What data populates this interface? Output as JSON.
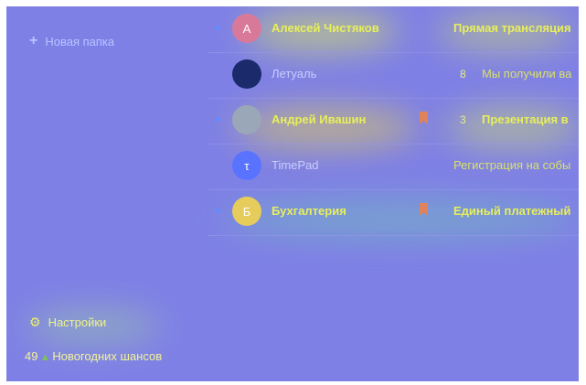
{
  "sidebar": {
    "new_folder_label": "Новая папка",
    "settings_label": "Настройки",
    "chances_count": "49",
    "chances_label": "Новогодних шансов"
  },
  "colors": {
    "background": "#7f80e6",
    "text_highlight": "#e8ef5a",
    "unread_dot": "#5f8cff",
    "bookmark": "#e0825a"
  },
  "messages": [
    {
      "unread": true,
      "avatar_letter": "А",
      "avatar_color": "#d9799a",
      "sender": "Алексей Чистяков",
      "bookmarked": false,
      "count": "",
      "subject": "Прямая трансляция"
    },
    {
      "unread": false,
      "avatar_letter": "",
      "avatar_color": "#1b2a6b",
      "sender": "Летуаль",
      "bookmarked": false,
      "count": "8",
      "subject": "Мы получили ва"
    },
    {
      "unread": true,
      "avatar_letter": "",
      "avatar_color": "#9aa7b8",
      "sender": "Андрей Ивашин",
      "bookmarked": true,
      "count": "3",
      "subject": "Презентация в"
    },
    {
      "unread": false,
      "avatar_letter": "τ",
      "avatar_color": "#5a73ff",
      "sender": "TimePad",
      "bookmarked": false,
      "count": "",
      "subject": "Регистрация на собы"
    },
    {
      "unread": true,
      "avatar_letter": "Б",
      "avatar_color": "#e6cc5a",
      "sender": "Бухгалтерия",
      "bookmarked": true,
      "count": "",
      "subject": "Единый платежный"
    }
  ]
}
